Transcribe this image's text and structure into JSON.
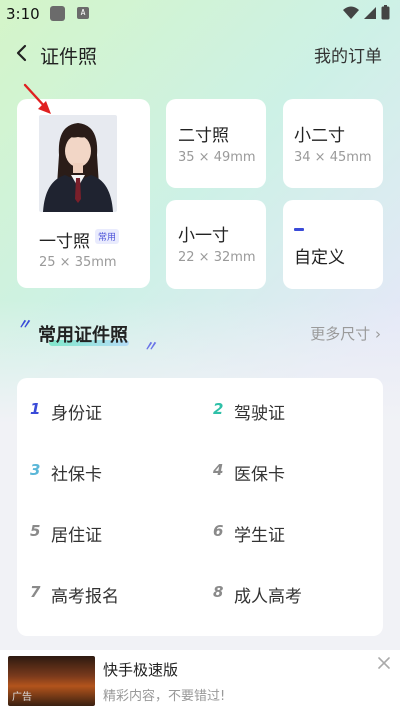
{
  "status": {
    "time": "3:10",
    "notif_icon": "A"
  },
  "header": {
    "title": "证件照",
    "orders": "我的订单"
  },
  "sizes": {
    "one_inch": {
      "name": "一寸照",
      "badge": "常用",
      "dim": "25 × 35mm"
    },
    "two_inch": {
      "name": "二寸照",
      "dim": "35 × 49mm"
    },
    "small_two": {
      "name": "小二寸",
      "dim": "34 × 45mm"
    },
    "small_one": {
      "name": "小一寸",
      "dim": "22 × 32mm"
    },
    "custom": {
      "name": "自定义"
    }
  },
  "section": {
    "title": "常用证件照",
    "more": "更多尺寸"
  },
  "common": [
    {
      "num": "1",
      "label": "身份证"
    },
    {
      "num": "2",
      "label": "驾驶证"
    },
    {
      "num": "3",
      "label": "社保卡"
    },
    {
      "num": "4",
      "label": "医保卡"
    },
    {
      "num": "5",
      "label": "居住证"
    },
    {
      "num": "6",
      "label": "学生证"
    },
    {
      "num": "7",
      "label": "高考报名"
    },
    {
      "num": "8",
      "label": "成人高考"
    }
  ],
  "ad": {
    "title": "快手极速版",
    "subtitle": "精彩内容，不要错过!",
    "tag": "广告"
  },
  "colors": {
    "accent": "#3a4bd8",
    "num_blue": "#3a4bd8",
    "num_teal": "#2fc0a8",
    "num_gray": "#8a8a8a",
    "arrow": "#e02020"
  }
}
